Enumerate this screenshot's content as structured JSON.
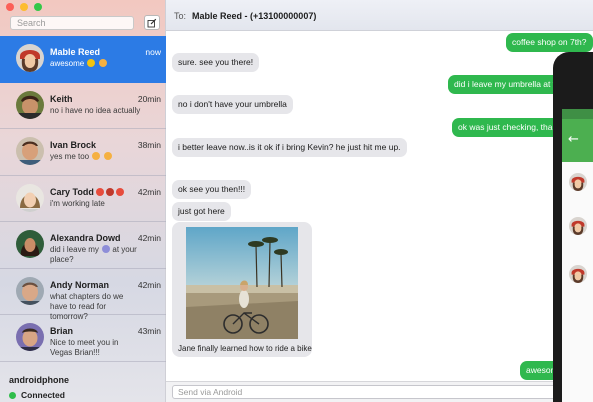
{
  "window": {
    "search_placeholder": "Search",
    "compose_icon": "compose-icon"
  },
  "conversations": [
    {
      "name": "Mable Reed",
      "time": "now",
      "preview": "awesome",
      "emojis": [
        "#f1c40f",
        "#f5b041"
      ],
      "active": true
    },
    {
      "name": "Keith",
      "time": "20min",
      "preview": "no i have no idea actually",
      "emojis": [],
      "active": false
    },
    {
      "name": "Ivan Brock",
      "time": "38min",
      "preview": "yes me too",
      "emojis": [
        "#f5b041",
        "#f5b041"
      ],
      "active": false
    },
    {
      "name": "Cary Todd",
      "time": "42min",
      "preview": "i'm working late",
      "emojis": [
        "#e74c3c",
        "#c0392b",
        "#e74c3c"
      ],
      "active": false
    },
    {
      "name": "Alexandra Dowd",
      "time": "42min",
      "preview": "did i leave my",
      "preview2": "at your place?",
      "emojis": [
        "#8e8ed8"
      ],
      "active": false
    },
    {
      "name": "Andy Norman",
      "time": "42min",
      "preview": "what chapters do we have to",
      "preview2": "read for tomorrow?",
      "emojis": [],
      "active": false
    },
    {
      "name": "Brian",
      "time": "43min",
      "preview": "Nice to meet you in Vegas",
      "preview2": "Brian!!!",
      "emojis": [],
      "active": false
    }
  ],
  "device": {
    "name": "androidphone",
    "status": "Connected",
    "status_color": "#2fbd4a"
  },
  "header": {
    "to_label": "To:",
    "recipient": "Mable Reed - (+13100000007)"
  },
  "messages": [
    {
      "dir": "out",
      "text": "coffee shop on 7th?"
    },
    {
      "dir": "in",
      "text": "sure. see you there!"
    },
    {
      "dir": "out",
      "text": "did i leave my umbrella at your place?"
    },
    {
      "dir": "in",
      "text": "no i don't have your umbrella"
    },
    {
      "dir": "out",
      "text": "ok was just checking, thanks!"
    },
    {
      "dir": "in",
      "text": "i better leave now..is it ok if i bring Kevin? he just hit me up."
    },
    {
      "dir": "in",
      "text": "ok see you then!!!"
    },
    {
      "dir": "in",
      "text": "just got here"
    },
    {
      "dir": "in",
      "text": "Jane finally learned how to ride a bike"
    },
    {
      "dir": "out",
      "text": "awesome"
    }
  ],
  "composer": {
    "placeholder": "Send via Android"
  },
  "colors": {
    "accent": "#2c7be5",
    "outgoing_bubble": "#2fb84e",
    "incoming_bubble": "#e6e6ea",
    "android_green": "#4caf50"
  }
}
